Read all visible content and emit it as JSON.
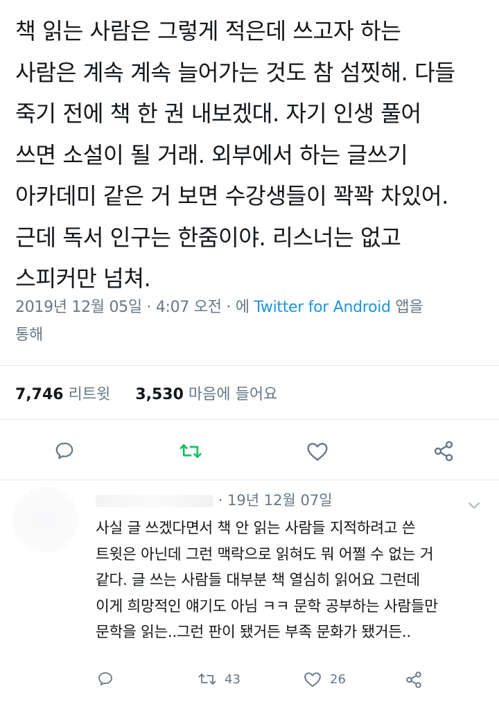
{
  "tweet": {
    "lines": [
      "책 읽는 사람은 그렇게 적은데 쓰고자 하는",
      "사람은 계속 계속 늘어가는 것도 참 섬찟해. 다들",
      "죽기 전에 책 한 권 내보겠대. 자기 인생 풀어",
      "쓰면 소설이 될 거래. 외부에서 하는 글쓰기",
      "아카데미 같은 거 보면 수강생들이 꽉꽉 차있어.",
      "근데 독서 인구는 한줌이야. 리스너는 없고",
      "스피커만 넘쳐."
    ],
    "timestamp": "2019년 12월 05일 · 4:07 오전 · 에",
    "source_app": "Twitter for Android",
    "source_suffix": "앱을",
    "source_line2": "통해"
  },
  "stats": {
    "retweets_count": "7,746",
    "retweets_label": "리트윗",
    "likes_count": "3,530",
    "likes_label": "마음에 들어요"
  },
  "colors": {
    "text": "#14171a",
    "secondary": "#657786",
    "link": "#1b95e0",
    "retweet_green": "#17bf63",
    "divider": "#e1e8ed"
  },
  "actions": {
    "reply_icon": "reply-icon",
    "retweet_icon": "retweet-icon",
    "like_icon": "heart-icon",
    "share_icon": "share-icon"
  },
  "reply": {
    "date": "· 19년 12월 07일",
    "lines": [
      "사실 글 쓰겠다면서 책 안 읽는 사람들 지적하려고 쓴",
      "트윗은 아닌데 그런 맥락으로 읽혀도 뭐 어쩔 수 없는 거",
      "같다. 글 쓰는 사람들 대부분 책 열심히 읽어요 그런데",
      "이게 희망적인 얘기도 아님 ㅋㅋ 문학 공부하는 사람들만",
      "문학을 읽는..그런 판이 됐거든 부족 문화가 됐거든.."
    ],
    "retweet_count": "43",
    "like_count": "26"
  }
}
